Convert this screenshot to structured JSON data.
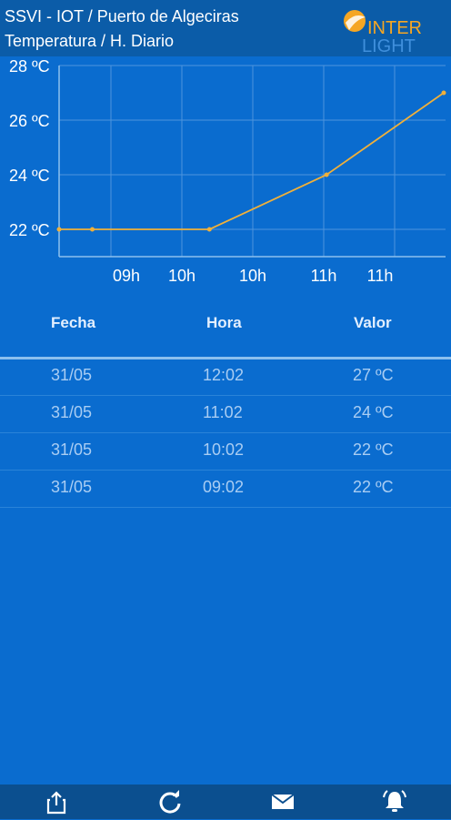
{
  "header": {
    "title_line1": "SSVI - IOT / Puerto de Algeciras",
    "title_line2": "Temperatura / H. Diario",
    "logo_text_top": "INTER",
    "logo_text_bottom": "LIGHT"
  },
  "chart_data": {
    "type": "line",
    "y_tick_labels": [
      "28 ºC",
      "26 ºC",
      "24 ºC",
      "22 ºC"
    ],
    "y_ticks": [
      28,
      26,
      24,
      22
    ],
    "x_tick_labels": [
      "09h",
      "10h",
      "10h",
      "11h",
      "11h"
    ],
    "ylim": [
      21,
      28
    ],
    "series": [
      {
        "values": [
          {
            "x": "08:45",
            "y": 22
          },
          {
            "x": "09:02",
            "y": 22
          },
          {
            "x": "10:02",
            "y": 22
          },
          {
            "x": "11:02",
            "y": 24
          },
          {
            "x": "12:02",
            "y": 27
          }
        ]
      }
    ],
    "grid": true,
    "line_color": "#f0b03a"
  },
  "table": {
    "headers": {
      "fecha": "Fecha",
      "hora": "Hora",
      "valor": "Valor"
    },
    "rows": [
      {
        "fecha": "31/05",
        "hora": "12:02",
        "valor": "27 ºC"
      },
      {
        "fecha": "31/05",
        "hora": "11:02",
        "valor": "24 ºC"
      },
      {
        "fecha": "31/05",
        "hora": "10:02",
        "valor": "22 ºC"
      },
      {
        "fecha": "31/05",
        "hora": "09:02",
        "valor": "22 ºC"
      }
    ]
  },
  "bottom_bar": {
    "icons": [
      "share-icon",
      "refresh-icon",
      "mail-icon",
      "alarm-bell-icon"
    ]
  },
  "colors": {
    "background": "#0a6ccf",
    "header": "#0b5ca8",
    "bottom_bar": "#0b4f8f",
    "accent_line": "#f0b03a"
  }
}
